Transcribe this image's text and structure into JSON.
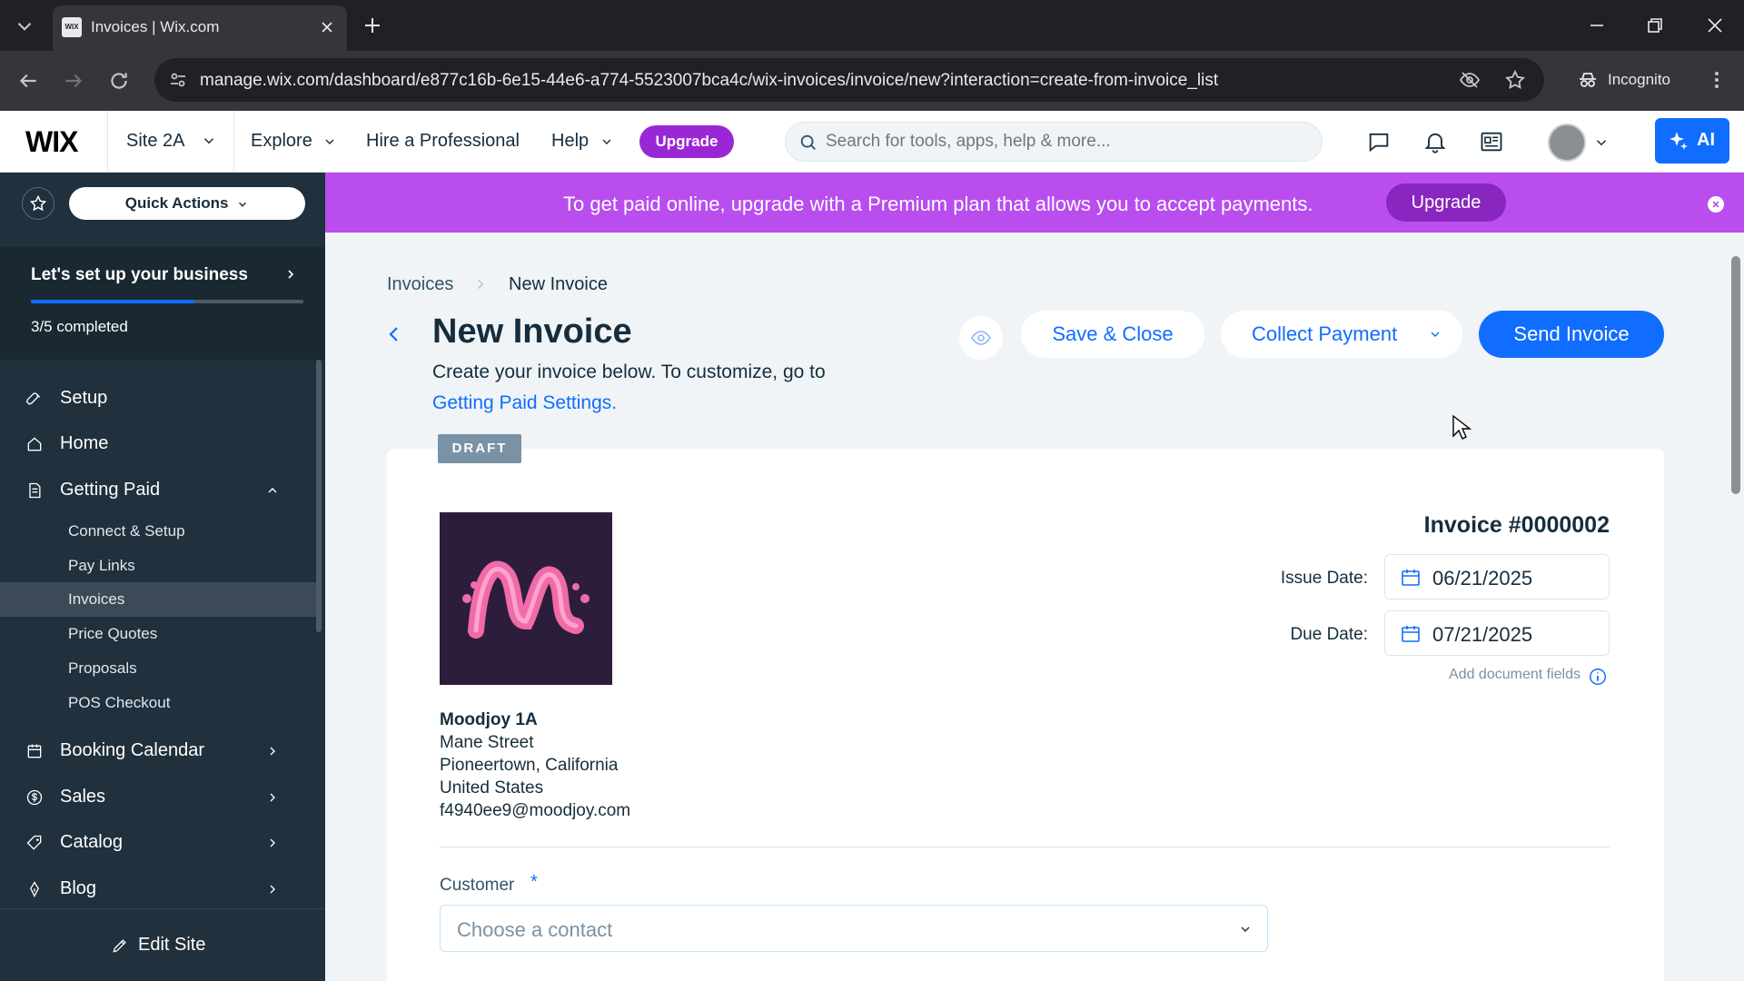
{
  "browser": {
    "tab_title": "Invoices | Wix.com",
    "favicon_text": "WIX",
    "url": "manage.wix.com/dashboard/e877c16b-6e15-44e6-a774-5523007bca4c/wix-invoices/invoice/new?interaction=create-from-invoice_list",
    "incognito_label": "Incognito"
  },
  "header": {
    "logo": "WIX",
    "site_name": "Site 2A",
    "nav": [
      "Explore",
      "Hire a Professional",
      "Help"
    ],
    "upgrade_label": "Upgrade",
    "search_placeholder": "Search for tools, apps, help & more...",
    "ai_label": "AI"
  },
  "sidebar": {
    "quick_actions": "Quick Actions",
    "setup_title": "Let's set up your business",
    "setup_progress_text": "3/5 completed",
    "setup_progress": 0.6,
    "items": [
      "Setup",
      "Home",
      "Getting Paid"
    ],
    "sub_items": [
      "Connect & Setup",
      "Pay Links",
      "Invoices",
      "Price Quotes",
      "Proposals",
      "POS Checkout"
    ],
    "active_sub_item": "Invoices",
    "more_items": [
      "Booking Calendar",
      "Sales",
      "Catalog",
      "Blog"
    ],
    "edit_site": "Edit Site"
  },
  "banner": {
    "text": "To get paid online, upgrade with a Premium plan that allows you to accept payments.",
    "button": "Upgrade"
  },
  "page": {
    "breadcrumb": [
      "Invoices",
      "New Invoice"
    ],
    "title": "New Invoice",
    "subtitle": "Create your invoice below. To customize, go to",
    "settings_link": "Getting Paid Settings.",
    "buttons": {
      "save_close": "Save & Close",
      "collect_payment": "Collect Payment",
      "send_invoice": "Send Invoice"
    },
    "status": "DRAFT"
  },
  "invoice": {
    "number": "Invoice #0000002",
    "issue_date_label": "Issue Date:",
    "issue_date": "06/21/2025",
    "due_date_label": "Due Date:",
    "due_date": "07/21/2025",
    "add_fields": "Add document fields",
    "business": {
      "name": "Moodjoy 1A",
      "street": "Mane Street",
      "city": "Pioneertown, California",
      "country": "United States",
      "email": "f4940ee9@moodjoy.com"
    },
    "customer_label": "Customer",
    "customer_required": "*",
    "customer_placeholder": "Choose a contact"
  },
  "colors": {
    "accent": "#116dff",
    "premium": "#9a27d5",
    "banner": "#b94dee",
    "sidebar": "#20303c"
  }
}
